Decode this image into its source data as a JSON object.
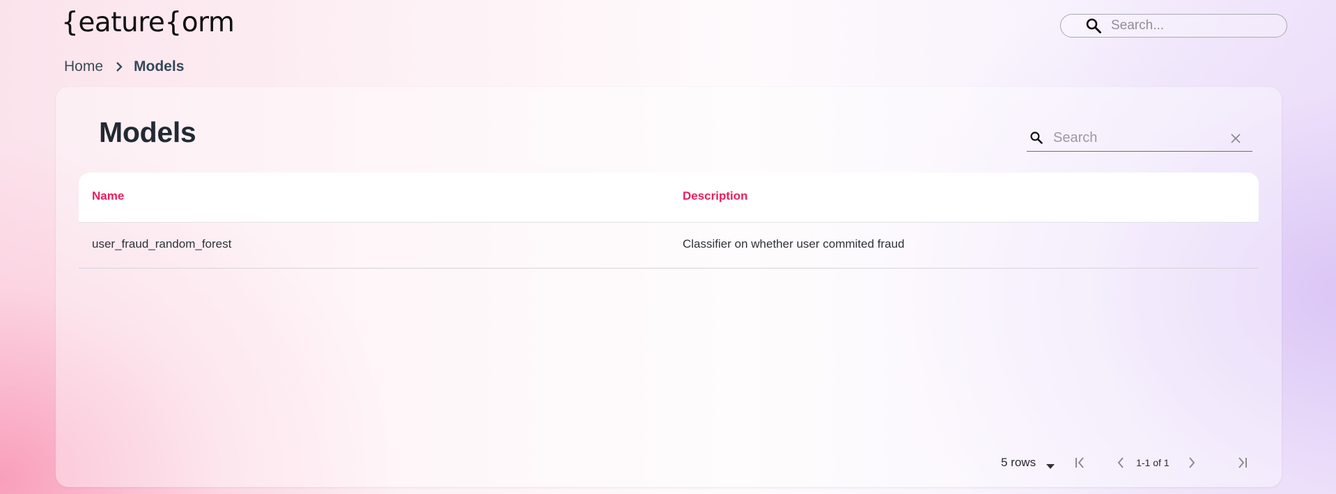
{
  "header": {
    "logo_text": "{eature{orm",
    "search_placeholder": "Search..."
  },
  "breadcrumb": {
    "home": "Home",
    "current": "Models"
  },
  "page": {
    "title": "Models",
    "search_placeholder": "Search"
  },
  "table": {
    "columns": [
      "Name",
      "Description"
    ],
    "rows": [
      {
        "name": "user_fraud_random_forest",
        "description": "Classifier on whether user commited fraud"
      }
    ]
  },
  "pagination": {
    "rows_per_page": "5 rows",
    "range": "1-1 of 1"
  },
  "colors": {
    "accent": "#ec1e5e",
    "text_dark": "#222a32"
  },
  "icons": {
    "global_search": "search-icon",
    "breadcrumb_sep": "chevron-right-icon",
    "table_search": "search-icon",
    "clear": "close-icon",
    "first": "first-page-icon",
    "prev": "chevron-left-icon",
    "next": "chevron-right-icon",
    "last": "last-page-icon"
  }
}
